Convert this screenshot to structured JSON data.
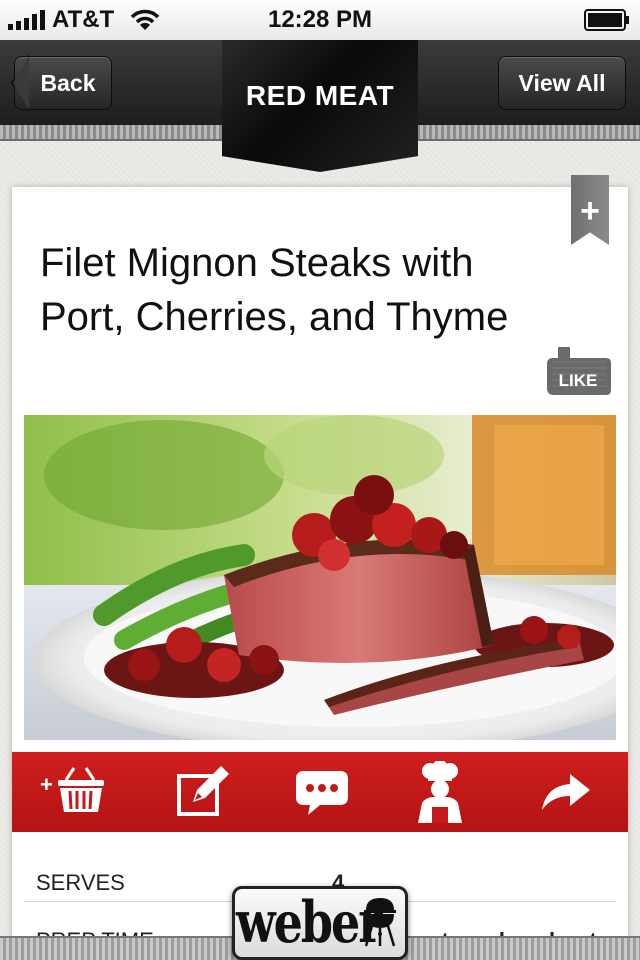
{
  "status_bar": {
    "carrier": "AT&T",
    "time": "12:28 PM",
    "signal_icon": "signal-bars-icon",
    "wifi_icon": "wifi-icon",
    "battery_icon": "battery-icon"
  },
  "nav": {
    "back_label": "Back",
    "title": "RED MEAT",
    "view_all_label": "View All"
  },
  "recipe": {
    "title": "Filet Mignon Steaks with Port, Cherries, and Thyme",
    "bookmark_symbol": "+",
    "like_label": "LIKE",
    "photo_icon": "steak-photo"
  },
  "actions": [
    {
      "name": "add-to-shopping-list-button",
      "icon": "basket-plus-icon"
    },
    {
      "name": "notes-button",
      "icon": "edit-note-icon"
    },
    {
      "name": "comments-button",
      "icon": "chat-bubble-icon"
    },
    {
      "name": "chef-button",
      "icon": "chef-icon"
    },
    {
      "name": "share-button",
      "icon": "share-arrow-icon"
    }
  ],
  "details": [
    {
      "label": "SERVES",
      "value": "4"
    },
    {
      "label": "PREP TIME",
      "value": "utes, plus about"
    }
  ],
  "brand": {
    "logo_text": "weber",
    "logo_icon": "kettle-grill-icon"
  },
  "colors": {
    "accent_red": "#c41a1a",
    "nav_dark": "#1e1e1e"
  }
}
